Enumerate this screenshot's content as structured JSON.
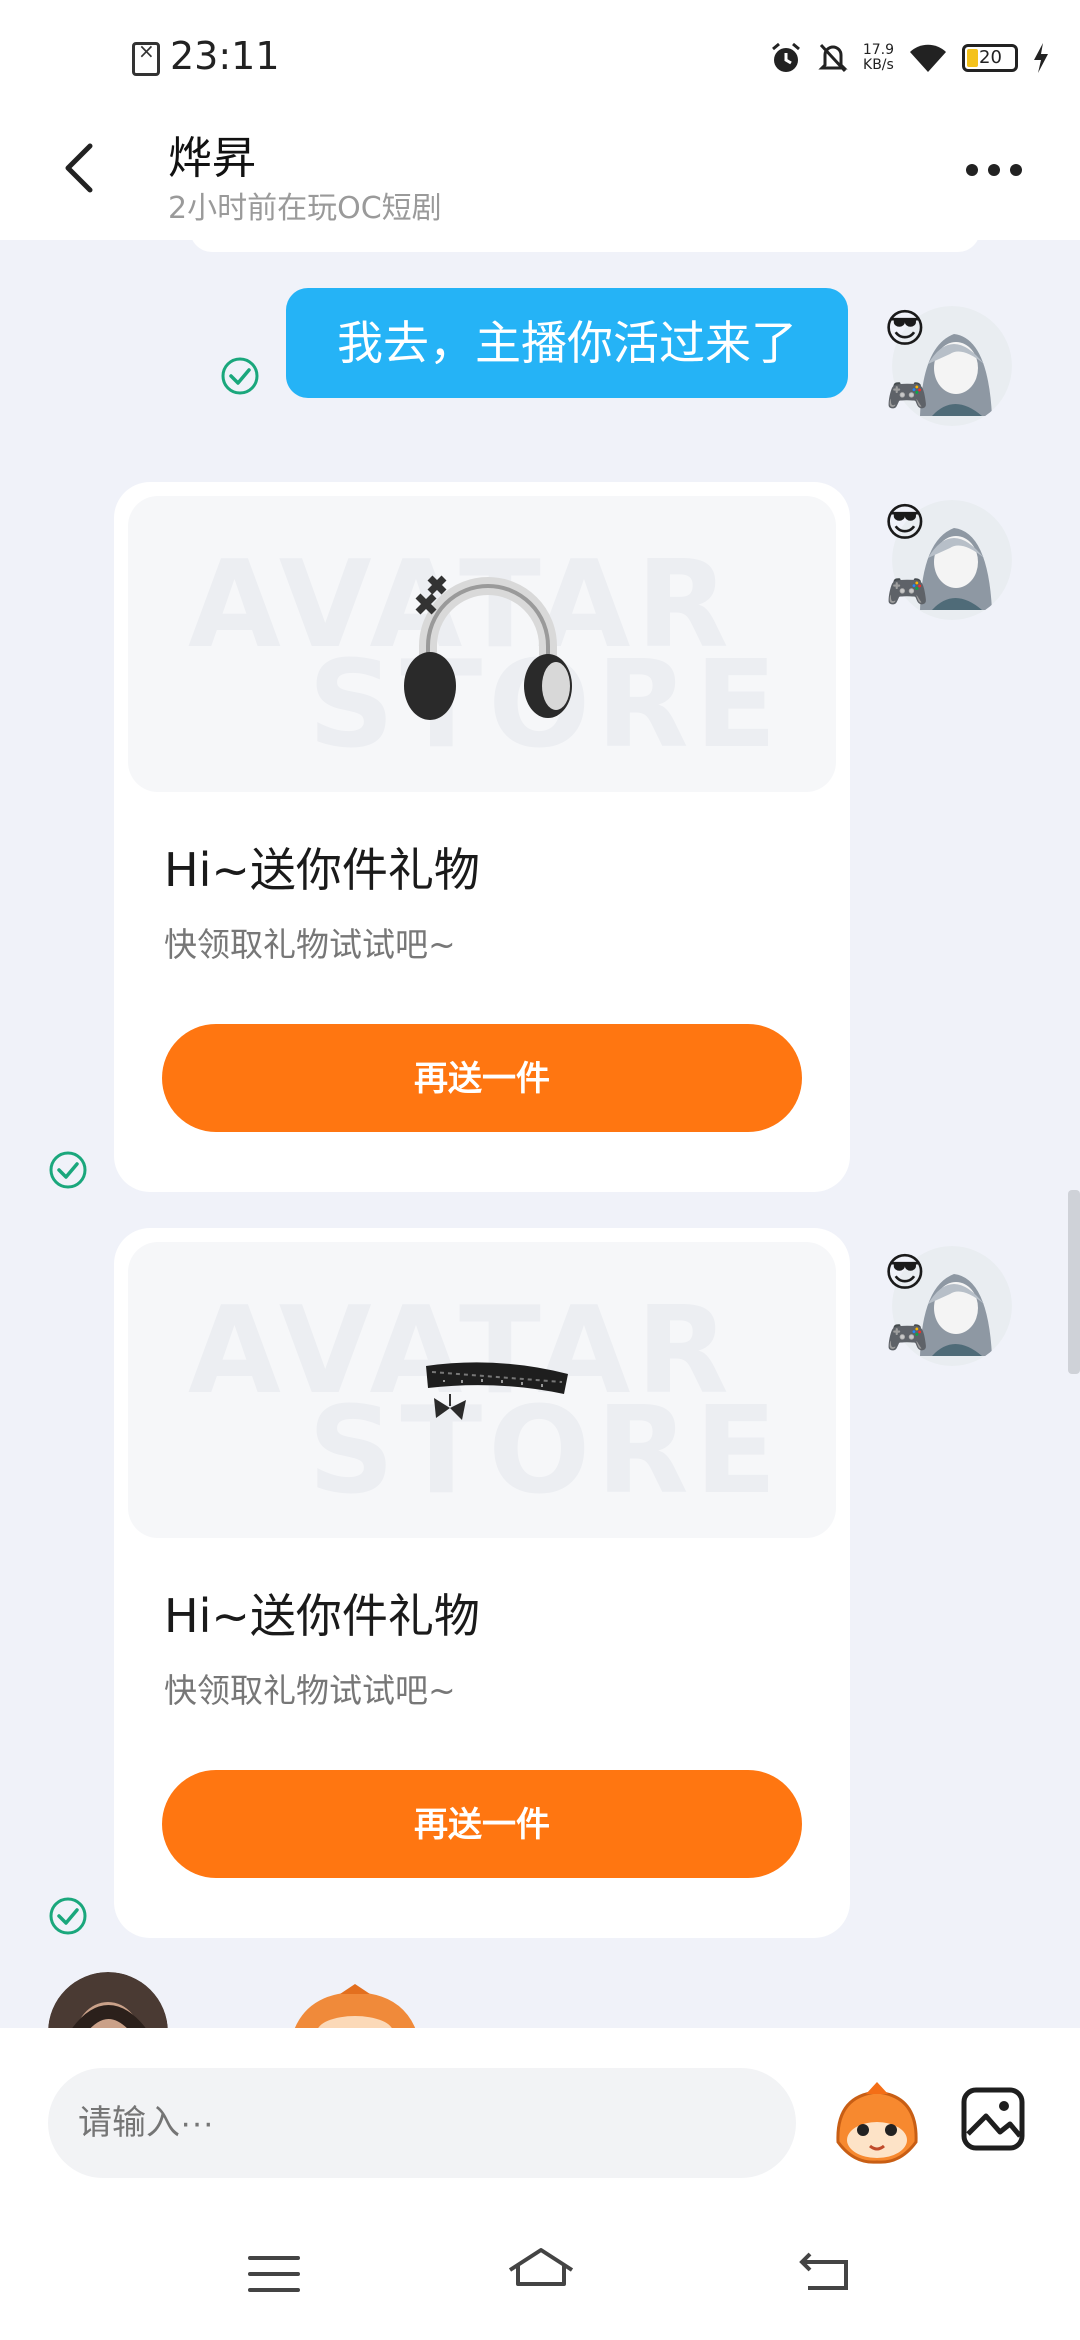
{
  "status_bar": {
    "time": "23:11",
    "net_speed_value": "17.9",
    "net_speed_unit": "KB/s",
    "battery": "20",
    "icons": [
      "doc-x-icon",
      "alarm-icon",
      "mute-bell-icon",
      "wifi-icon",
      "battery-icon",
      "charging-icon"
    ]
  },
  "header": {
    "title": "烨昇",
    "subtitle": "2小时前在玩OC短剧"
  },
  "messages": [
    {
      "type": "text",
      "text": "我去，主播你活过来了",
      "status": "read"
    },
    {
      "type": "gift",
      "image": "headphones",
      "watermark_line1": "AVATAR",
      "watermark_line2": "STORE",
      "title": "Hi~送你件礼物",
      "subtitle": "快领取礼物试试吧~",
      "button": "再送一件"
    },
    {
      "type": "gift",
      "image": "lace-choker",
      "watermark_line1": "AVATAR",
      "watermark_line2": "STORE",
      "title": "Hi~送你件礼物",
      "subtitle": "快领取礼物试试吧~",
      "button": "再送一件"
    }
  ],
  "input": {
    "placeholder": "请输入···"
  },
  "colors": {
    "bubble": "#25b3f6",
    "button": "#ff7611",
    "check": "#1aa77c",
    "background": "#f0f2f9"
  }
}
